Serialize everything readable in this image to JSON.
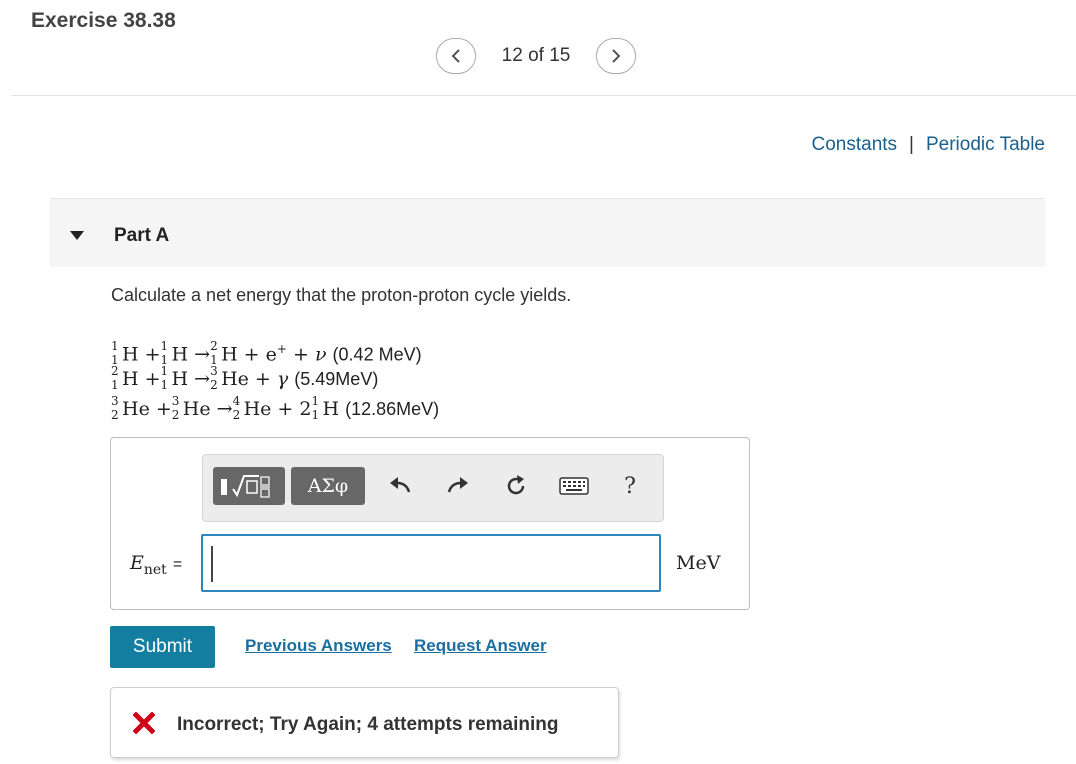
{
  "header": {
    "exercise_title": "Exercise 38.38",
    "pager_text": "12 of 15"
  },
  "resources": {
    "constants": "Constants",
    "separator": "|",
    "periodic_table": "Periodic Table"
  },
  "part": {
    "title": "Part A",
    "question": "Calculate a net energy that the proton-proton cycle yields."
  },
  "equations": [
    {
      "energy": "(0.42 MeV)"
    },
    {
      "energy": "(5.49MeV)"
    },
    {
      "energy": "(12.86MeV)"
    }
  ],
  "toolbar": {
    "greek_label": "ΑΣφ",
    "help_label": "?"
  },
  "answer": {
    "variable": "E",
    "variable_sub": "net",
    "equals": "=",
    "value": "",
    "unit": "MeV"
  },
  "actions": {
    "submit": "Submit",
    "previous_answers": "Previous Answers",
    "request_answer": "Request Answer"
  },
  "feedback": {
    "message": "Incorrect; Try Again; 4 attempts remaining",
    "color": "#d0021b"
  },
  "colors": {
    "link": "#1b5f8e",
    "submit_bg": "#137ea0",
    "input_border": "#2e86c1"
  }
}
